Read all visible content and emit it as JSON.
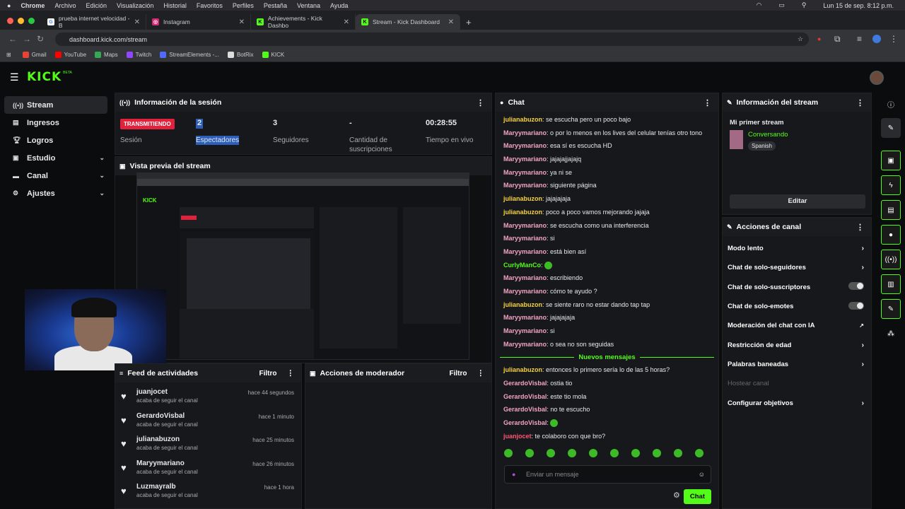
{
  "macbar": {
    "app": "Chrome",
    "menus": [
      "Archivo",
      "Edición",
      "Visualización",
      "Historial",
      "Favoritos",
      "Perfiles",
      "Pestaña",
      "Ventana",
      "Ayuda"
    ],
    "clock": "Lun 15 de sep. 8:12 p.m."
  },
  "tabs": [
    {
      "label": "prueba internet velocidad - B",
      "icon": "google-icon"
    },
    {
      "label": "Instagram",
      "icon": "instagram-icon"
    },
    {
      "label": "Achievements - Kick Dashbo",
      "icon": "kick-icon"
    },
    {
      "label": "Stream - Kick Dashboard",
      "icon": "kick-icon"
    }
  ],
  "address": {
    "url": "dashboard.kick.com/stream"
  },
  "bookmarks": [
    {
      "label": "Gmail",
      "color": "#ea4335"
    },
    {
      "label": "YouTube",
      "color": "#ff0000"
    },
    {
      "label": "Maps",
      "color": "#34a853"
    },
    {
      "label": "Twitch",
      "color": "#9146ff"
    },
    {
      "label": "StreamElements -...",
      "color": "#4f6bff"
    },
    {
      "label": "BotRix",
      "color": "#dddddd"
    },
    {
      "label": "KICK",
      "color": "#53fc18"
    }
  ],
  "brand": {
    "logo": "KICK",
    "beta": "BETA"
  },
  "sidebar": [
    {
      "label": "Stream",
      "icon": "broadcast-icon",
      "active": true
    },
    {
      "label": "Ingresos",
      "icon": "wallet-icon"
    },
    {
      "label": "Logros",
      "icon": "trophy-icon"
    },
    {
      "label": "Estudio",
      "icon": "studio-icon",
      "expandable": true
    },
    {
      "label": "Canal",
      "icon": "channel-icon",
      "expandable": true
    },
    {
      "label": "Ajustes",
      "icon": "gear-icon",
      "expandable": true
    }
  ],
  "session": {
    "title": "Información de la sesión",
    "live_badge": "TRANSMITIENDO",
    "live_label": "Sesión",
    "stats": [
      {
        "value": "2",
        "label": "Espectadores"
      },
      {
        "value": "3",
        "label": "Seguidores"
      },
      {
        "value": "-",
        "label": "Cantidad de suscripciones"
      },
      {
        "value": "00:28:55",
        "label": "Tiempo en vivo"
      }
    ]
  },
  "preview": {
    "title": "Vista previa del stream"
  },
  "feed": {
    "title": "Feed de actividades",
    "filter": "Filtro",
    "items": [
      {
        "user": "juanjocet",
        "action": "acaba de seguir el canal",
        "time": "hace 44 segundos"
      },
      {
        "user": "GerardoVisbal",
        "action": "acaba de seguir el canal",
        "time": "hace 1 minuto"
      },
      {
        "user": "julianabuzon",
        "action": "acaba de seguir el canal",
        "time": "hace 25 minutos"
      },
      {
        "user": "Maryymariano",
        "action": "acaba de seguir el canal",
        "time": "hace 26 minutos"
      },
      {
        "user": "Luzmayralb",
        "action": "acaba de seguir el canal",
        "time": "hace 1 hora"
      }
    ]
  },
  "modactions": {
    "title": "Acciones de moderador",
    "filter": "Filtro"
  },
  "chat": {
    "title": "Chat",
    "messages": [
      {
        "user": "julianabuzon",
        "color": "#f5d33c",
        "text": "se escucha pero un poco bajo"
      },
      {
        "user": "Maryymariano",
        "color": "#f2a3c6",
        "text": "o por lo menos en los lives del celular tenías otro tono"
      },
      {
        "user": "Maryymariano",
        "color": "#f2a3c6",
        "text": "esa sí es escucha HD"
      },
      {
        "user": "Maryymariano",
        "color": "#f2a3c6",
        "text": "jajajajjajajq"
      },
      {
        "user": "Maryymariano",
        "color": "#f2a3c6",
        "text": "ya ni se"
      },
      {
        "user": "Maryymariano",
        "color": "#f2a3c6",
        "text": "siguiente página"
      },
      {
        "user": "julianabuzon",
        "color": "#f5d33c",
        "text": "jajajajaja"
      },
      {
        "user": "julianabuzon",
        "color": "#f5d33c",
        "text": "poco a poco vamos mejorando jajaja"
      },
      {
        "user": "Maryymariano",
        "color": "#f2a3c6",
        "text": "se escucha como una interferencia"
      },
      {
        "user": "Maryymariano",
        "color": "#f2a3c6",
        "text": "si"
      },
      {
        "user": "Maryymariano",
        "color": "#f2a3c6",
        "text": "está bien así"
      },
      {
        "user": "CurlyManCo",
        "color": "#53fc18",
        "text": ""
      },
      {
        "user": "Maryymariano",
        "color": "#f2a3c6",
        "text": "escribiendo"
      },
      {
        "user": "Maryymariano",
        "color": "#f2a3c6",
        "text": "cómo te ayudo ?"
      },
      {
        "user": "julianabuzon",
        "color": "#f5d33c",
        "text": "se siente raro no estar dando tap tap"
      },
      {
        "user": "Maryymariano",
        "color": "#f2a3c6",
        "text": "jajajajaja"
      },
      {
        "user": "Maryymariano",
        "color": "#f2a3c6",
        "text": "si"
      },
      {
        "user": "Maryymariano",
        "color": "#f2a3c6",
        "text": "o sea no son seguidas"
      }
    ],
    "new_label": "Nuevos mensajes",
    "new_messages": [
      {
        "user": "julianabuzon",
        "color": "#f5d33c",
        "text": "entonces lo primero sería lo de las 5 horas?"
      },
      {
        "user": "GerardoVisbal",
        "color": "#f2a3c6",
        "text": "ostia tio"
      },
      {
        "user": "GerardoVisbal",
        "color": "#f2a3c6",
        "text": "este tio mola"
      },
      {
        "user": "GerardoVisbal",
        "color": "#f2a3c6",
        "text": "no te escucho"
      },
      {
        "user": "GerardoVisbal",
        "color": "#f2a3c6",
        "text": ""
      },
      {
        "user": "juanjocet",
        "color": "#ff5577",
        "text": "te colaboro con que bro?"
      }
    ],
    "input_placeholder": "Enviar un mensaje",
    "send": "Chat"
  },
  "stream_info": {
    "title": "Información del stream",
    "stream_title": "Mi primer stream",
    "category": "Conversando",
    "language": "Spanish",
    "edit": "Editar"
  },
  "channel_actions": {
    "title": "Acciones de canal",
    "items": [
      {
        "label": "Modo lento",
        "control": "chevron"
      },
      {
        "label": "Chat de solo-seguidores",
        "control": "chevron"
      },
      {
        "label": "Chat de solo-suscriptores",
        "control": "toggle"
      },
      {
        "label": "Chat de solo-emotes",
        "control": "toggle"
      },
      {
        "label": "Moderación del chat con IA",
        "control": "external"
      },
      {
        "label": "Restricción de edad",
        "control": "chevron"
      },
      {
        "label": "Palabras baneadas",
        "control": "chevron"
      },
      {
        "label": "Hostear canal",
        "control": "none",
        "disabled": true
      },
      {
        "label": "Configurar objetivos",
        "control": "chevron"
      }
    ]
  }
}
